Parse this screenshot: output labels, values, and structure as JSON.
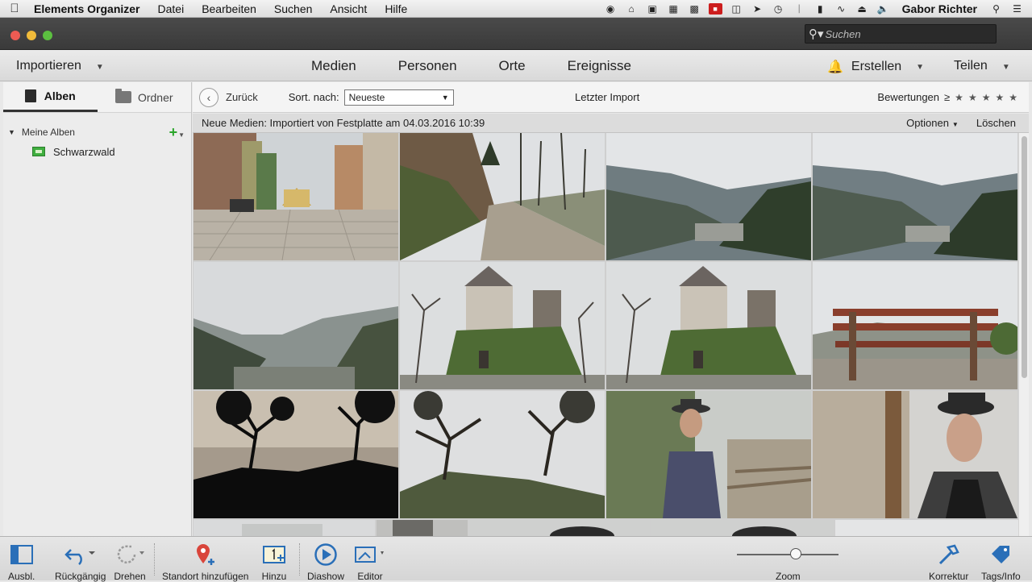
{
  "menubar": {
    "app_name": "Elements Organizer",
    "items": [
      "Datei",
      "Bearbeiten",
      "Suchen",
      "Ansicht",
      "Hilfe"
    ],
    "user": "Gabor Richter"
  },
  "window": {
    "search_placeholder": "Suchen"
  },
  "maintoolbar": {
    "import_label": "Importieren",
    "tabs": [
      "Medien",
      "Personen",
      "Orte",
      "Ereignisse"
    ],
    "create_label": "Erstellen",
    "share_label": "Teilen"
  },
  "sidebar": {
    "tab_albums": "Alben",
    "tab_folders": "Ordner",
    "section_title": "Meine Alben",
    "albums": [
      "Schwarzwald"
    ]
  },
  "content_toolbar": {
    "back_label": "Zurück",
    "sort_label": "Sort. nach:",
    "sort_value": "Neueste",
    "title": "Letzter Import",
    "ratings_label": "Bewertungen",
    "ratings_operator": "≥"
  },
  "infobar": {
    "message": "Neue Medien: Importiert von Festplatte am 04.03.2016 10:39",
    "options_label": "Optionen",
    "delete_label": "Löschen"
  },
  "photos": [
    "town-street",
    "forest-path",
    "valley-mountains-1",
    "valley-mountains-2",
    "misty-valley",
    "castle-ruin-1",
    "castle-ruin-2",
    "wooden-bench",
    "tree-silhouette",
    "tree-on-rock",
    "man-with-hat-1",
    "man-with-hat-2"
  ],
  "bottombar": {
    "items": [
      "Ausbl.",
      "Rückgängig",
      "Drehen",
      "Standort hinzufügen",
      "Hinzu",
      "Diashow",
      "Editor"
    ],
    "zoom_label": "Zoom",
    "zoom_level": 0.58,
    "right_items": [
      "Korrektur",
      "Tags/Info"
    ]
  },
  "colors": {
    "accent_blue": "#2e7fd6",
    "add_green": "#2aa52a",
    "pin_red": "#d9453b"
  }
}
